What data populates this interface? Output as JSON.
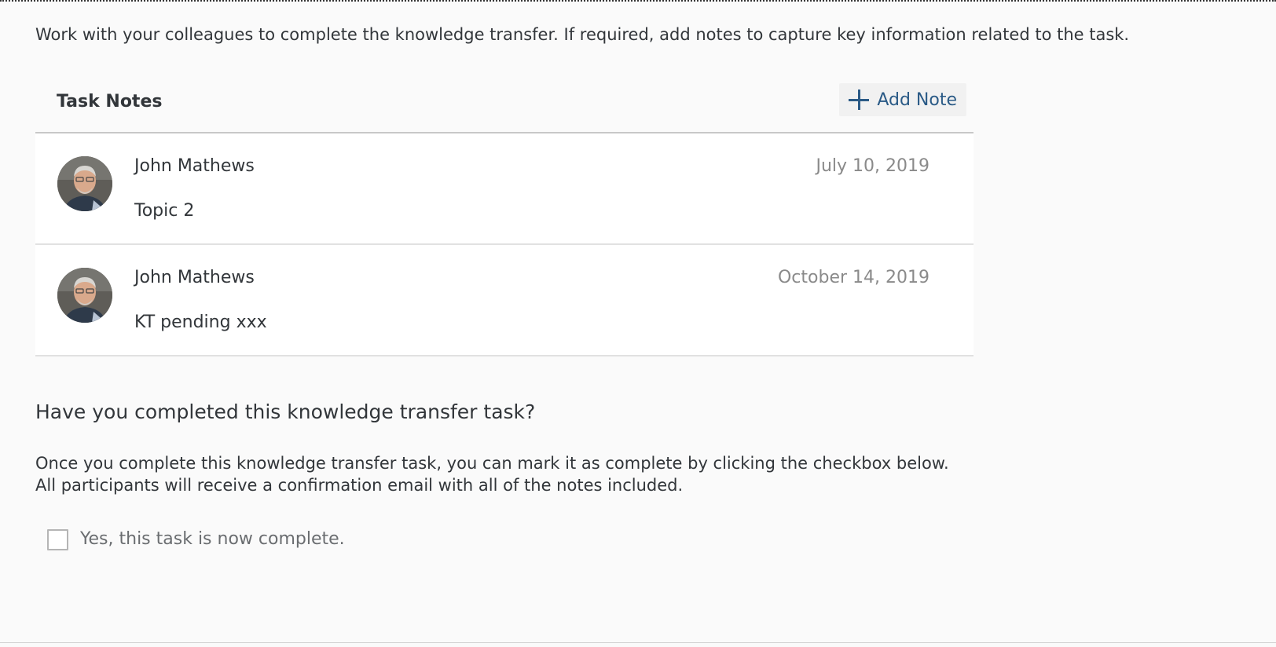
{
  "intro_text": "Work with your colleagues to complete the knowledge transfer. If required, add notes to capture key information related to the task.",
  "notes": {
    "title": "Task Notes",
    "add_label": "Add Note",
    "items": [
      {
        "author": "John Mathews",
        "date": "July 10, 2019",
        "text": "Topic 2",
        "avatar_icon": "user-photo"
      },
      {
        "author": "John Mathews",
        "date": "October 14, 2019",
        "text": "KT pending xxx",
        "avatar_icon": "user-photo"
      }
    ]
  },
  "completion": {
    "question": "Have you completed this knowledge transfer task?",
    "explain_line1": "Once you complete this knowledge transfer task, you can mark it as complete by clicking the checkbox below.",
    "explain_line2": "All participants will receive a confirmation email with all of the notes included.",
    "checkbox_label": "Yes, this task is now complete.",
    "checked": false
  },
  "colors": {
    "accent": "#2a5a86",
    "background": "#fafafa",
    "date_text": "#8a8a8a"
  }
}
